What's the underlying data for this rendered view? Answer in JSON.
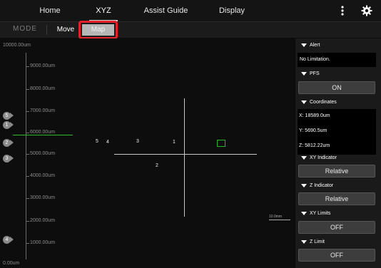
{
  "tabs": [
    {
      "label": "Home",
      "active": false
    },
    {
      "label": "XYZ",
      "active": true
    },
    {
      "label": "Assist Guide",
      "active": false
    },
    {
      "label": "Display",
      "active": false
    }
  ],
  "menu_icon": "vertical-dots-icon",
  "settings_icon": "gear-icon",
  "mode": {
    "label": "MODE",
    "move_label": "Move",
    "map_label": "Map"
  },
  "map": {
    "y_labels": [
      "10000.00um",
      "9000.00um",
      "8000.00um",
      "7000.00um",
      "6000.00um",
      "5000.00um",
      "4000.00um",
      "3000.00um",
      "2000.00um",
      "1000.00um",
      "0.00um"
    ],
    "points": [
      "5",
      "4",
      "3",
      "1",
      "2"
    ],
    "markers": [
      "5",
      "1",
      "2",
      "3",
      "4"
    ],
    "scale_label": "10.0mm"
  },
  "panel": {
    "alert": {
      "title": "Alert",
      "value": "No Limitation."
    },
    "pfs": {
      "title": "PFS",
      "button": "ON"
    },
    "coordinates": {
      "title": "Coordinates",
      "x": "X: 18589.0um",
      "y": "Y: 5690.5um",
      "z": "Z: 5812.22um"
    },
    "xy_indicator": {
      "title": "XY Indicator",
      "button": "Relative"
    },
    "z_indicator": {
      "title": "Z Indicator",
      "button": "Relative"
    },
    "xy_limits": {
      "title": "XY Limits",
      "button": "OFF"
    },
    "z_limit": {
      "title": "Z Limit",
      "button": "OFF"
    }
  },
  "colors": {
    "highlight": "#e4202a",
    "green": "#2bc02b",
    "button_bg": "#3d3d3d"
  }
}
